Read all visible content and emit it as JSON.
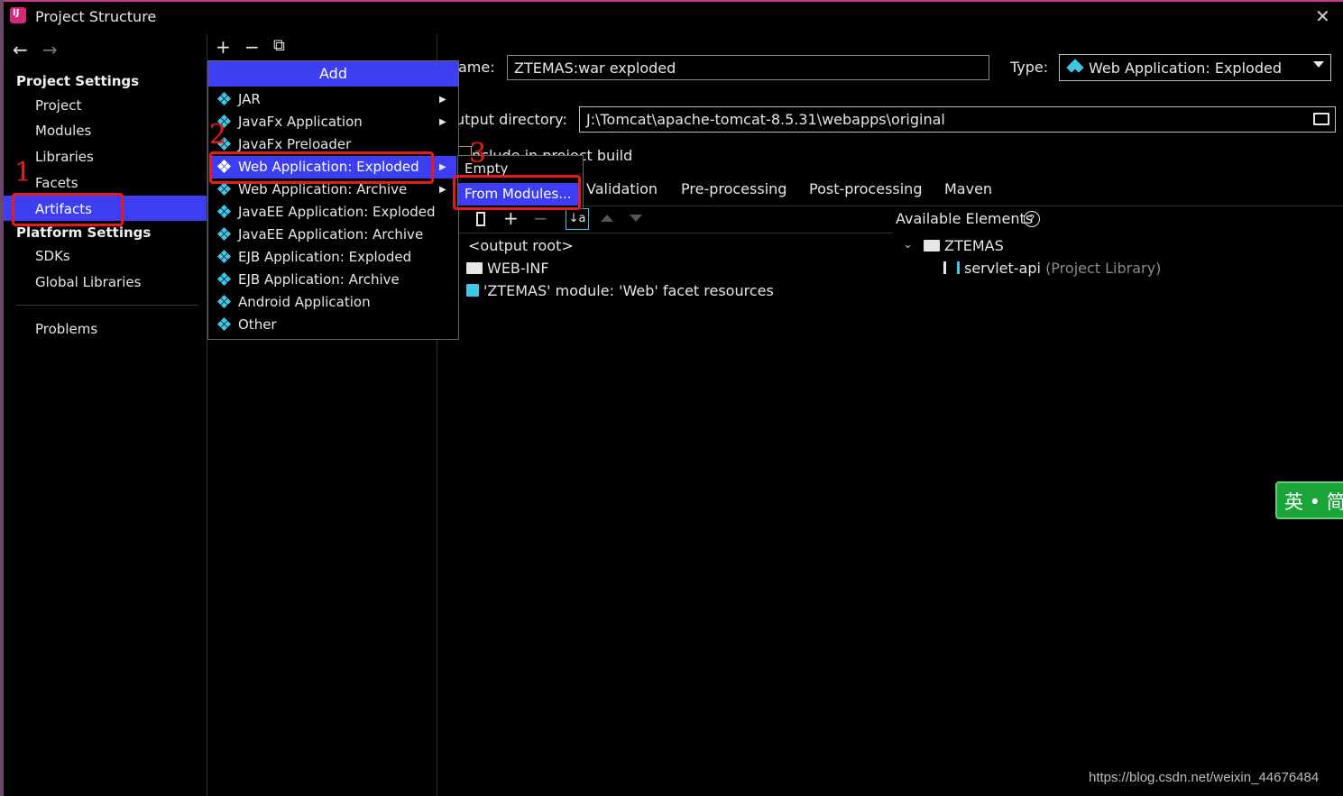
{
  "window": {
    "title": "Project Structure",
    "close_icon": "close-icon"
  },
  "nav": {
    "back_icon": "←",
    "forward_icon": "→"
  },
  "sidebar": {
    "project_settings_label": "Project Settings",
    "project_settings_items": [
      "Project",
      "Modules",
      "Libraries",
      "Facets",
      "Artifacts"
    ],
    "selected": "Artifacts",
    "platform_settings_label": "Platform Settings",
    "platform_settings_items": [
      "SDKs",
      "Global Libraries"
    ],
    "problems_label": "Problems"
  },
  "toolbar": {
    "add": "+",
    "remove": "−",
    "copy": "⧉"
  },
  "add_menu": {
    "header": "Add",
    "items": [
      {
        "label": "JAR",
        "submenu": true
      },
      {
        "label": "JavaFx Application",
        "submenu": true
      },
      {
        "label": "JavaFx Preloader",
        "submenu": false
      },
      {
        "label": "Web Application: Exploded",
        "submenu": true,
        "selected": true
      },
      {
        "label": "Web Application: Archive",
        "submenu": true
      },
      {
        "label": "JavaEE Application: Exploded",
        "submenu": false
      },
      {
        "label": "JavaEE Application: Archive",
        "submenu": false
      },
      {
        "label": "EJB Application: Exploded",
        "submenu": false
      },
      {
        "label": "EJB Application: Archive",
        "submenu": false
      },
      {
        "label": "Android Application",
        "submenu": false
      },
      {
        "label": "Other",
        "submenu": false
      }
    ]
  },
  "sub_menu": {
    "items": [
      "Empty",
      "From Modules..."
    ],
    "selected": "From Modules..."
  },
  "annotations": {
    "step1": "1",
    "step2": "2",
    "step3": "3"
  },
  "artifact": {
    "name_label": "ame:",
    "name_value": "ZTEMAS:war exploded",
    "type_label": "Type:",
    "type_value": "Web Application: Exploded",
    "output_label": "utput directory:",
    "output_value": "J:\\Tomcat\\apache-tomcat-8.5.31\\webapps\\original",
    "include_label": "nclude in project build"
  },
  "tabs": [
    "Validation",
    "Pre-processing",
    "Post-processing",
    "Maven"
  ],
  "layout_tree": {
    "rows": [
      "<output root>",
      "WEB-INF",
      "'ZTEMAS' module: 'Web' facet resources"
    ]
  },
  "available": {
    "header": "Available Elements",
    "module": "ZTEMAS",
    "library": "servlet-api",
    "library_suffix": "(Project Library)"
  },
  "ime": {
    "label": "英 • 简"
  },
  "watermark": "https://blog.csdn.net/weixin_44676484",
  "colors": {
    "accent": "#3d3df3",
    "annotation": "#e51c1c",
    "background": "#000000"
  }
}
